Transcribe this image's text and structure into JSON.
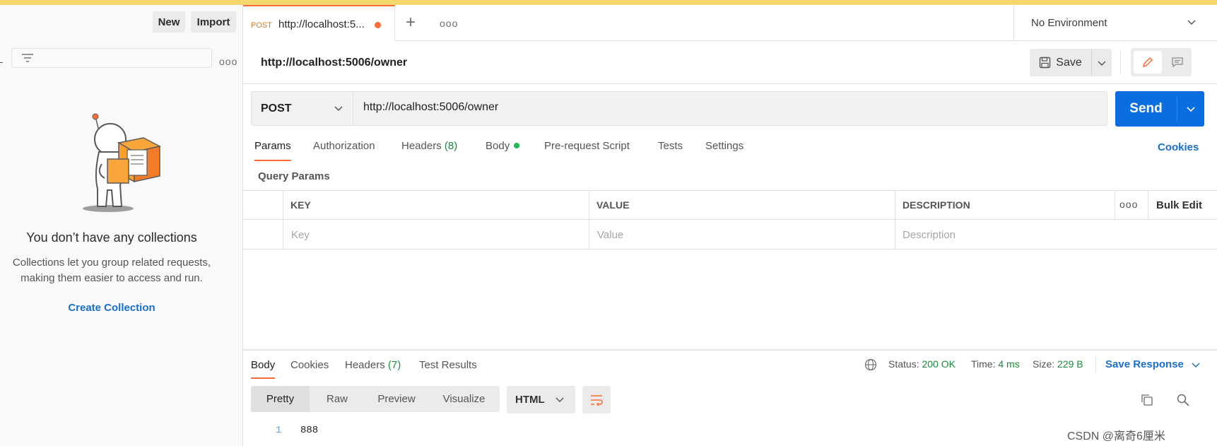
{
  "sidebar": {
    "new_label": "New",
    "import_label": "Import",
    "empty_title": "You don’t have any collections",
    "empty_desc_line1": "Collections let you group related requests,",
    "empty_desc_line2": "making them easier to access and run.",
    "create_label": "Create Collection"
  },
  "tab": {
    "method": "POST",
    "url": "http://localhost:5..."
  },
  "environment": {
    "label": "No Environment"
  },
  "request": {
    "title": "http://localhost:5006/owner",
    "save_label": "Save",
    "method": "POST",
    "url": "http://localhost:5006/owner",
    "send_label": "Send",
    "tabs": {
      "params": "Params",
      "authorization": "Authorization",
      "headers": "Headers",
      "headers_count": "(8)",
      "body": "Body",
      "pre_request": "Pre-request Script",
      "tests": "Tests",
      "settings": "Settings"
    },
    "cookies_label": "Cookies",
    "query_params_label": "Query Params"
  },
  "params_table": {
    "headers": {
      "key": "KEY",
      "value": "VALUE",
      "description": "DESCRIPTION",
      "bulk_edit": "Bulk Edit"
    },
    "placeholders": {
      "key": "Key",
      "value": "Value",
      "description": "Description"
    }
  },
  "response": {
    "tabs": {
      "body": "Body",
      "cookies": "Cookies",
      "headers": "Headers",
      "headers_count": "(7)",
      "test_results": "Test Results"
    },
    "status_label": "Status:",
    "status_value": "200 OK",
    "time_label": "Time:",
    "time_value": "4 ms",
    "size_label": "Size:",
    "size_value": "229 B",
    "save_response_label": "Save Response",
    "views": {
      "pretty": "Pretty",
      "raw": "Raw",
      "preview": "Preview",
      "visualize": "Visualize"
    },
    "format": "HTML",
    "lines": [
      {
        "num": "1",
        "text": "888"
      }
    ]
  },
  "watermark": "CSDN @离奇6厘米",
  "colors": {
    "accent": "#ff6c37",
    "send": "#0b6ee0",
    "link": "#1a6fc9",
    "success": "#1a8a3a",
    "top_bar": "#f5d76e"
  }
}
